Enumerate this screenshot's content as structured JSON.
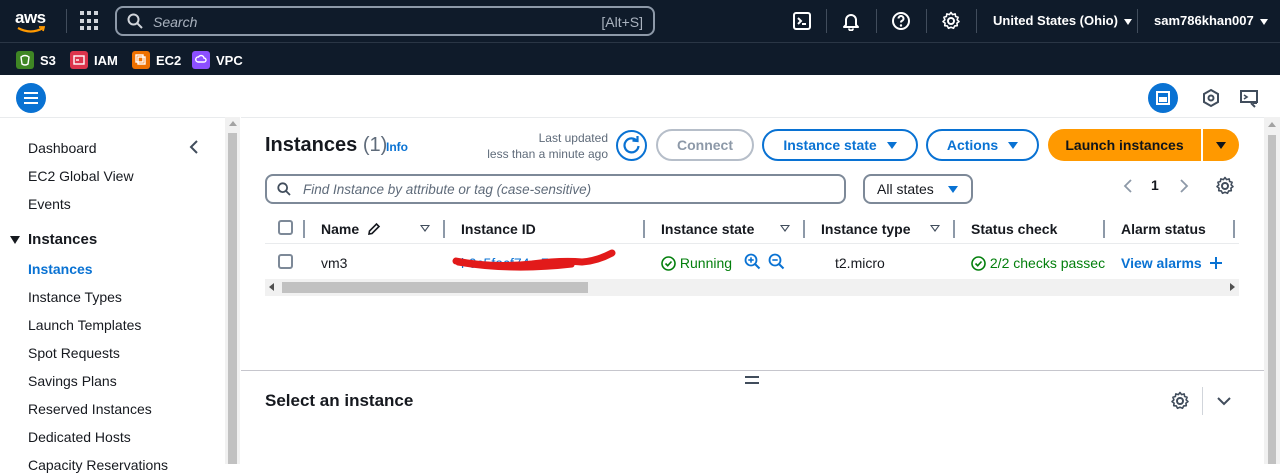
{
  "topnav": {
    "search_placeholder": "Search",
    "search_shortcut": "[Alt+S]",
    "region": "United States (Ohio)",
    "user": "sam786khan007"
  },
  "favorites": [
    {
      "label": "S3",
      "color": "#3f8624"
    },
    {
      "label": "IAM",
      "color": "#dd344c"
    },
    {
      "label": "EC2",
      "color": "#ed7100"
    },
    {
      "label": "VPC",
      "color": "#8c4fff"
    }
  ],
  "sidebar": {
    "items_top": [
      "Dashboard",
      "EC2 Global View",
      "Events"
    ],
    "section": "Instances",
    "items": [
      "Instances",
      "Instance Types",
      "Launch Templates",
      "Spot Requests",
      "Savings Plans",
      "Reserved Instances",
      "Dedicated Hosts",
      "Capacity Reservations"
    ]
  },
  "main": {
    "title": "Instances",
    "count": "(1)",
    "info": "Info",
    "last_updated_label": "Last updated",
    "last_updated_value": "less than a minute ago",
    "connect": "Connect",
    "instance_state": "Instance state",
    "actions": "Actions",
    "launch": "Launch instances",
    "filter_placeholder": "Find Instance by attribute or tag (case-sensitive)",
    "state_filter": "All states",
    "page": "1"
  },
  "table": {
    "columns": [
      "Name",
      "Instance ID",
      "Instance state",
      "Instance type",
      "Status check",
      "Alarm status"
    ],
    "row": {
      "name": "vm3",
      "instance_id": "i-0c5facf74...72",
      "state": "Running",
      "type": "t2.micro",
      "status": "2/2 checks passec",
      "alarm": "View alarms"
    }
  },
  "details": {
    "title": "Select an instance"
  },
  "colors": {
    "accent": "#0972d3",
    "nav_bg": "#0f1b2a",
    "launch": "#ff9900",
    "success": "#037f0c",
    "redaction": "#e21a1a"
  }
}
